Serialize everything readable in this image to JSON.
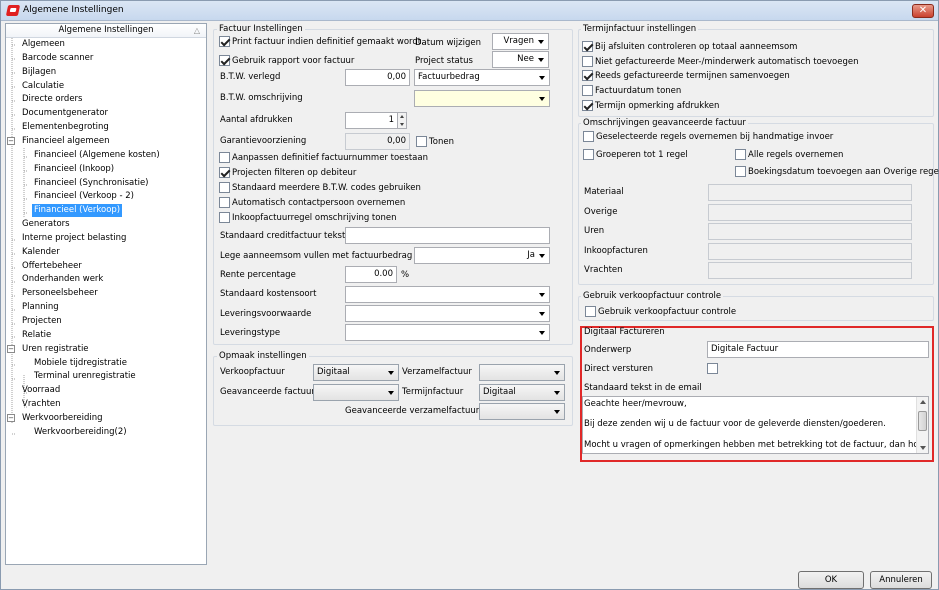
{
  "window": {
    "title": "Algemene Instellingen",
    "close_glyph": "✕"
  },
  "tree": {
    "header": "Algemene Instellingen",
    "sort_glyph": "△",
    "items": [
      "Algemeen",
      "Barcode scanner",
      "Bijlagen",
      "Calculatie",
      "Directe orders",
      "Documentgenerator",
      "Elementenbegroting",
      "Financieel algemeen",
      "Financieel (Algemene kosten)",
      "Financieel (Inkoop)",
      "Financieel (Synchronisatie)",
      "Financieel (Verkoop - 2)",
      "Financieel (Verkoop)",
      "Generators",
      "Interne project belasting",
      "Kalender",
      "Offertebeheer",
      "Onderhanden werk",
      "Personeelsbeheer",
      "Planning",
      "Projecten",
      "Relatie",
      "Uren registratie",
      "Mobiele tijdregistratie",
      "Terminal urenregistratie",
      "Voorraad",
      "Vrachten",
      "Werkvoorbereiding",
      "Werkvoorbereiding(2)"
    ],
    "expand_glyph": "−"
  },
  "factuur": {
    "title": "Factuur Instellingen",
    "print_label": "Print factuur indien definitief gemaakt wordt.",
    "datum_label": "Datum wijzigen",
    "datum_value": "Vragen",
    "rapport_label": "Gebruik rapport voor factuur",
    "project_status_label": "Project status",
    "project_status_value": "Nee",
    "btw_verlegd_label": "B.T.W. verlegd",
    "btw_verlegd_value": "0,00",
    "btw_type_value": "Factuurbedrag",
    "btw_omschrijving_label": "B.T.W. omschrijving",
    "btw_omschrijving_value": "",
    "aantal_label": "Aantal afdrukken",
    "aantal_value": "1",
    "garantie_label": "Garantievoorziening",
    "garantie_value": "0,00",
    "tonen_label": "Tonen",
    "checks": [
      "Aanpassen definitief factuurnummer toestaan",
      "Projecten filteren op debiteur",
      "Standaard meerdere B.T.W. codes gebruiken",
      "Automatisch contactpersoon overnemen",
      "Inkoopfactuurregel omschrijving tonen"
    ],
    "credit_label": "Standaard creditfactuur tekst",
    "credit_value": "",
    "lege_label": "Lege aanneemsom vullen met factuurbedrag",
    "lege_value": "Ja",
    "rente_label": "Rente percentage",
    "rente_value": "0.00",
    "rente_unit": "%",
    "kostensoort_label": "Standaard kostensoort",
    "kostensoort_value": "",
    "leveringsvoorwaarde_label": "Leveringsvoorwaarde",
    "leveringsvoorwaarde_value": "",
    "leveringstype_label": "Leveringstype",
    "leveringstype_value": ""
  },
  "opmaak": {
    "title": "Opmaak instellingen",
    "verkoop_label": "Verkoopfactuur",
    "verkoop_value": "Digitaal",
    "verzamel_label": "Verzamelfactuur",
    "verzamel_value": "",
    "geavanceerde_label": "Geavanceerde factuur",
    "geavanceerde_value": "",
    "termijn_label": "Termijnfactuur",
    "termijn_value": "Digitaal",
    "geav_verzamel_label": "Geavanceerde verzamelfactuur",
    "geav_verzamel_value": ""
  },
  "termijn": {
    "title": "Termijnfactuur instellingen",
    "checks": [
      {
        "label": "Bij afsluiten controleren op totaal aanneemsom",
        "checked": true
      },
      {
        "label": "Niet gefactureerde Meer-/minderwerk automatisch toevoegen",
        "checked": false
      },
      {
        "label": "Reeds gefactureerde termijnen samenvoegen",
        "checked": true
      },
      {
        "label": "Factuurdatum tonen",
        "checked": false
      },
      {
        "label": "Termijn opmerking afdrukken",
        "checked": true
      }
    ]
  },
  "omschrijvingen": {
    "title": "Omschrijvingen geavanceerde factuur",
    "regels_label": "Geselecteerde regels overnemen bij handmatige invoer",
    "groeperen_label": "Groeperen tot 1 regel",
    "alle_label": "Alle regels overnemen",
    "boeking_label": "Boekingsdatum toevoegen aan Overige regel",
    "fields": [
      "Materiaal",
      "Overige",
      "Uren",
      "Inkoopfacturen",
      "Vrachten"
    ]
  },
  "verkoopcontrole": {
    "title": "Gebruik verkoopfactuur controle",
    "check_label": "Gebruik verkoopfactuur controle"
  },
  "digitaal": {
    "title": "Digitaal Factureren",
    "onderwerp_label": "Onderwerp",
    "onderwerp_value": "Digitale Factuur",
    "direct_label": "Direct versturen",
    "tekst_label": "Standaard tekst in de email",
    "lines": [
      "Geachte heer/mevrouw,",
      "Bij deze zenden wij u de factuur voor de geleverde diensten/goederen.",
      "Mocht u vragen of opmerkingen hebben met betrekking tot de factuur, dan hoor ik"
    ]
  },
  "buttons": {
    "ok": "OK",
    "cancel": "Annuleren"
  },
  "colors": {
    "selection": "#3399ff",
    "highlight": "#e02828"
  }
}
